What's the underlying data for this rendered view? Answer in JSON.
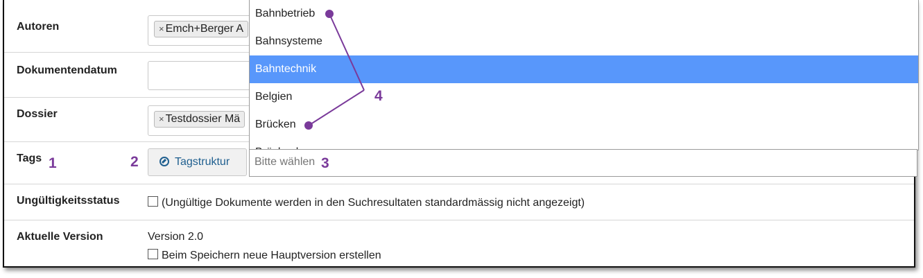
{
  "form": {
    "authors": {
      "label": "Autoren",
      "chip": "Emch+Berger A"
    },
    "document_date": {
      "label": "Dokumentendatum",
      "value": ""
    },
    "dossier": {
      "label": "Dossier",
      "chip": "Testdossier Mä"
    },
    "tags": {
      "label": "Tags",
      "button_label": "Tagstruktur",
      "search_placeholder": "Bitte wählen"
    },
    "invalidity_status": {
      "label": "Ungültigkeitsstatus",
      "checkbox_text": "(Ungültige Dokumente werden in den Suchresultaten standardmässig nicht angezeigt)"
    },
    "current_version": {
      "label": "Aktuelle Version",
      "value": "Version 2.0",
      "checkbox_text": "Beim Speichern neue Hauptversion erstellen"
    }
  },
  "dropdown": {
    "options": [
      "Bahnbetrieb",
      "Bahnsysteme",
      "Bahntechnik",
      "Belgien",
      "Brücken",
      "Brückenb..."
    ],
    "selected": "Bahntechnik"
  },
  "annotations": {
    "n1": "1",
    "n2": "2",
    "n3": "3",
    "n4": "4"
  },
  "chip_remove_glyph": "×",
  "colors": {
    "annotation": "#7a3a9a",
    "highlight": "#5897fb",
    "link": "#1f5f8f"
  }
}
